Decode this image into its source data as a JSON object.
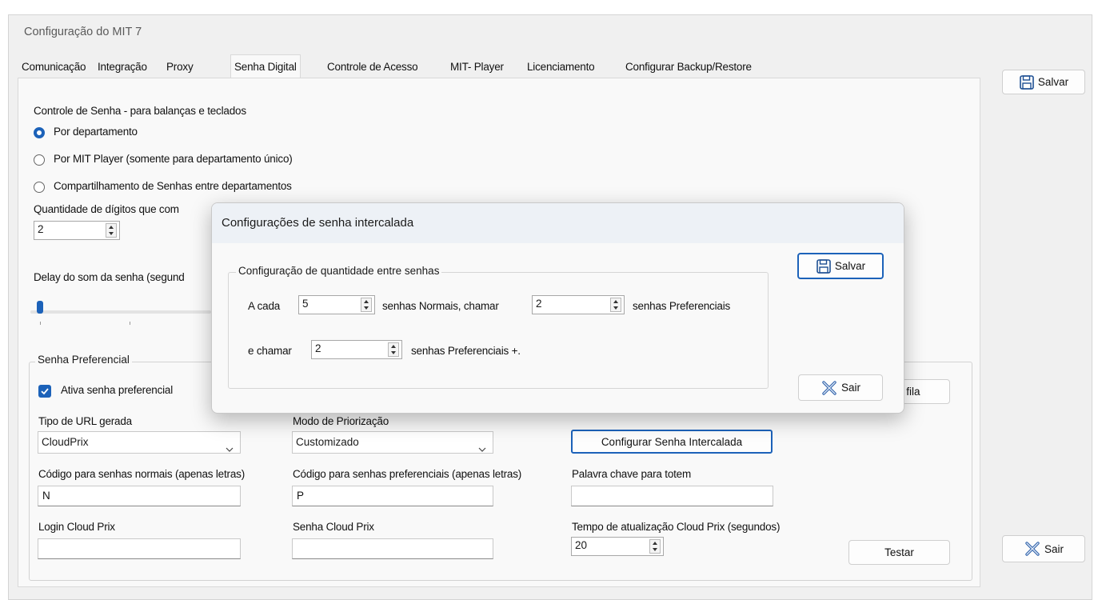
{
  "window": {
    "title": "Configuração do MIT 7"
  },
  "tabs": [
    {
      "label": "Comunicação"
    },
    {
      "label": "Integração"
    },
    {
      "label": "Proxy"
    },
    {
      "label": "Senha Digital",
      "active": true
    },
    {
      "label": "Controle de Acesso"
    },
    {
      "label": "MIT- Player"
    },
    {
      "label": "Licenciamento"
    },
    {
      "label": "Configurar Backup/Restore"
    }
  ],
  "side": {
    "save_label": "Salvar",
    "exit_label": "Sair"
  },
  "senha": {
    "controle_title": "Controle de Senha - para balanças e teclados",
    "radios": [
      {
        "label": "Por departamento",
        "selected": true
      },
      {
        "label": "Por MIT Player (somente para departamento único)",
        "selected": false
      },
      {
        "label": "Compartilhamento de Senhas entre departamentos",
        "selected": false
      }
    ],
    "digits_label": "Quantidade de dígitos que com",
    "digits_value": "2",
    "delay_label": "Delay do som da senha (segund"
  },
  "preferencial": {
    "group_title": "Senha Preferencial",
    "ativa_label": "Ativa senha preferencial",
    "ativa_checked": true,
    "fila_button_fragment": "r fila",
    "tipo_url_label": "Tipo de URL gerada",
    "tipo_url_value": "CloudPrix",
    "modo_label": "Modo de Priorização",
    "modo_value": "Customizado",
    "config_intercalada_button": "Configurar Senha Intercalada",
    "cod_normais_label": "Código para senhas normais (apenas letras)",
    "cod_normais_value": "N",
    "cod_pref_label": "Código para senhas preferenciais (apenas letras)",
    "cod_pref_value": "P",
    "palavra_label": "Palavra chave para totem",
    "palavra_value": "",
    "login_label": "Login Cloud Prix",
    "login_value": "",
    "senha_label": "Senha Cloud Prix",
    "senha_value": "",
    "tempo_label": "Tempo de atualização Cloud Prix (segundos)",
    "tempo_value": "20",
    "testar_button": "Testar"
  },
  "modal": {
    "title": "Configurações de senha intercalada",
    "group_title": "Configuração de quantidade entre senhas",
    "a_cada_label": "A cada",
    "a_cada_value": "5",
    "normais_label": "senhas Normais, chamar",
    "chamar_value": "2",
    "preferenciais_label": "senhas Preferenciais",
    "e_chamar_label": "e chamar",
    "e_chamar_value": "2",
    "pref_plus_label": "senhas Preferenciais +.",
    "save_label": "Salvar",
    "exit_label": "Sair"
  },
  "colors": {
    "accent": "#1c62b9",
    "window_bg": "#f0f0f0",
    "panel_bg": "#f9f9f9"
  },
  "icons": {
    "save": "save-icon",
    "exit": "close-x-icon",
    "dropdown": "chevron-down-icon"
  }
}
